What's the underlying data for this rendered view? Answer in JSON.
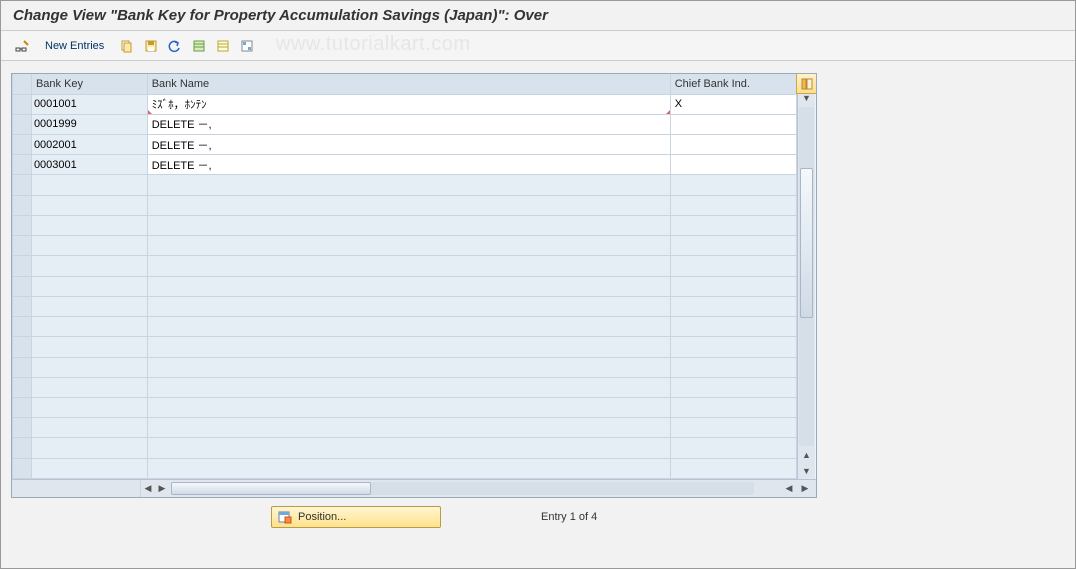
{
  "header": {
    "title": "Change View \"Bank Key for Property Accumulation Savings (Japan)\": Over"
  },
  "toolbar": {
    "new_entries_label": "New Entries"
  },
  "watermark_text": "www.tutorialkart.com",
  "table": {
    "columns": {
      "bank_key": "Bank Key",
      "bank_name": "Bank Name",
      "chief_bank": "Chief Bank Ind."
    },
    "rows": [
      {
        "bank_key": "0001001",
        "bank_name": "ﾐｽﾞﾎ，ﾎﾝﾃﾝ",
        "chief": "X"
      },
      {
        "bank_key": "0001999",
        "bank_name": "DELETE －,",
        "chief": ""
      },
      {
        "bank_key": "0002001",
        "bank_name": "DELETE －,",
        "chief": ""
      },
      {
        "bank_key": "0003001",
        "bank_name": "DELETE －,",
        "chief": ""
      }
    ],
    "empty_row_count": 15
  },
  "footer": {
    "position_label": "Position...",
    "entry_text": "Entry 1 of 4"
  }
}
